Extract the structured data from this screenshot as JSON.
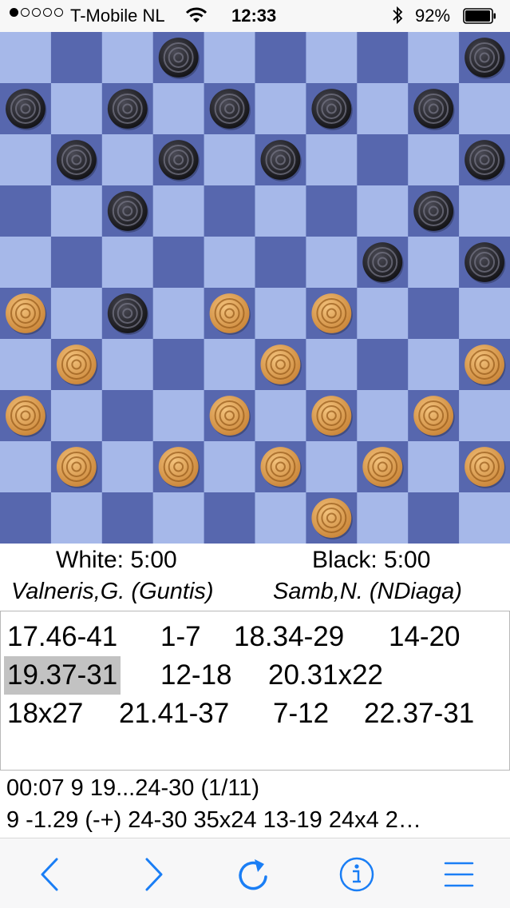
{
  "status_bar": {
    "carrier": "T-Mobile NL",
    "time": "12:33",
    "battery": "92%",
    "signal_icon": "signal-dots-icon",
    "wifi_icon": "wifi-icon",
    "bluetooth_icon": "bluetooth-icon",
    "battery_icon": "battery-icon"
  },
  "board": {
    "size": 10,
    "colors": {
      "light": "#a6b8e9",
      "dark": "#5767ae",
      "black_piece": "#1e1e24",
      "white_piece": "#e3a35a"
    },
    "pieces": {
      "black": [
        [
          0,
          3
        ],
        [
          0,
          9
        ],
        [
          1,
          0
        ],
        [
          1,
          2
        ],
        [
          1,
          4
        ],
        [
          1,
          6
        ],
        [
          1,
          8
        ],
        [
          2,
          1
        ],
        [
          2,
          3
        ],
        [
          2,
          5
        ],
        [
          2,
          9
        ],
        [
          3,
          2
        ],
        [
          3,
          8
        ],
        [
          4,
          7
        ],
        [
          4,
          9
        ],
        [
          5,
          2
        ]
      ],
      "white": [
        [
          5,
          0
        ],
        [
          5,
          4
        ],
        [
          5,
          6
        ],
        [
          6,
          1
        ],
        [
          6,
          5
        ],
        [
          6,
          9
        ],
        [
          7,
          0
        ],
        [
          7,
          4
        ],
        [
          7,
          6
        ],
        [
          7,
          8
        ],
        [
          8,
          1
        ],
        [
          8,
          3
        ],
        [
          8,
          5
        ],
        [
          8,
          7
        ],
        [
          8,
          9
        ],
        [
          9,
          6
        ]
      ]
    }
  },
  "players": {
    "white_clock": "White:  5:00",
    "black_clock": "Black:  5:00",
    "white_name": "Valneris,G. (Guntis)",
    "black_name": "Samb,N. (NDiaga)"
  },
  "moves": {
    "rows": [
      [
        "17.46-41",
        "1-7",
        "18.34-29",
        "14-20"
      ],
      [
        "19.37-31",
        "12-18",
        "20.31x22"
      ],
      [
        "18x27",
        "21.41-37",
        "7-12",
        "22.37-31"
      ]
    ],
    "current": "19.37-31"
  },
  "analysis": {
    "line1": "00:07 9 19...24-30 (1/11)",
    "line2": "9 -1.29 (-+) 24-30 35x24 13-19 24x4 2…"
  },
  "toolbar": {
    "back_icon": "chevron-left-icon",
    "forward_icon": "chevron-right-icon",
    "refresh_icon": "refresh-icon",
    "info_icon": "info-icon",
    "menu_icon": "menu-icon",
    "accent": "#1a7ef5"
  }
}
